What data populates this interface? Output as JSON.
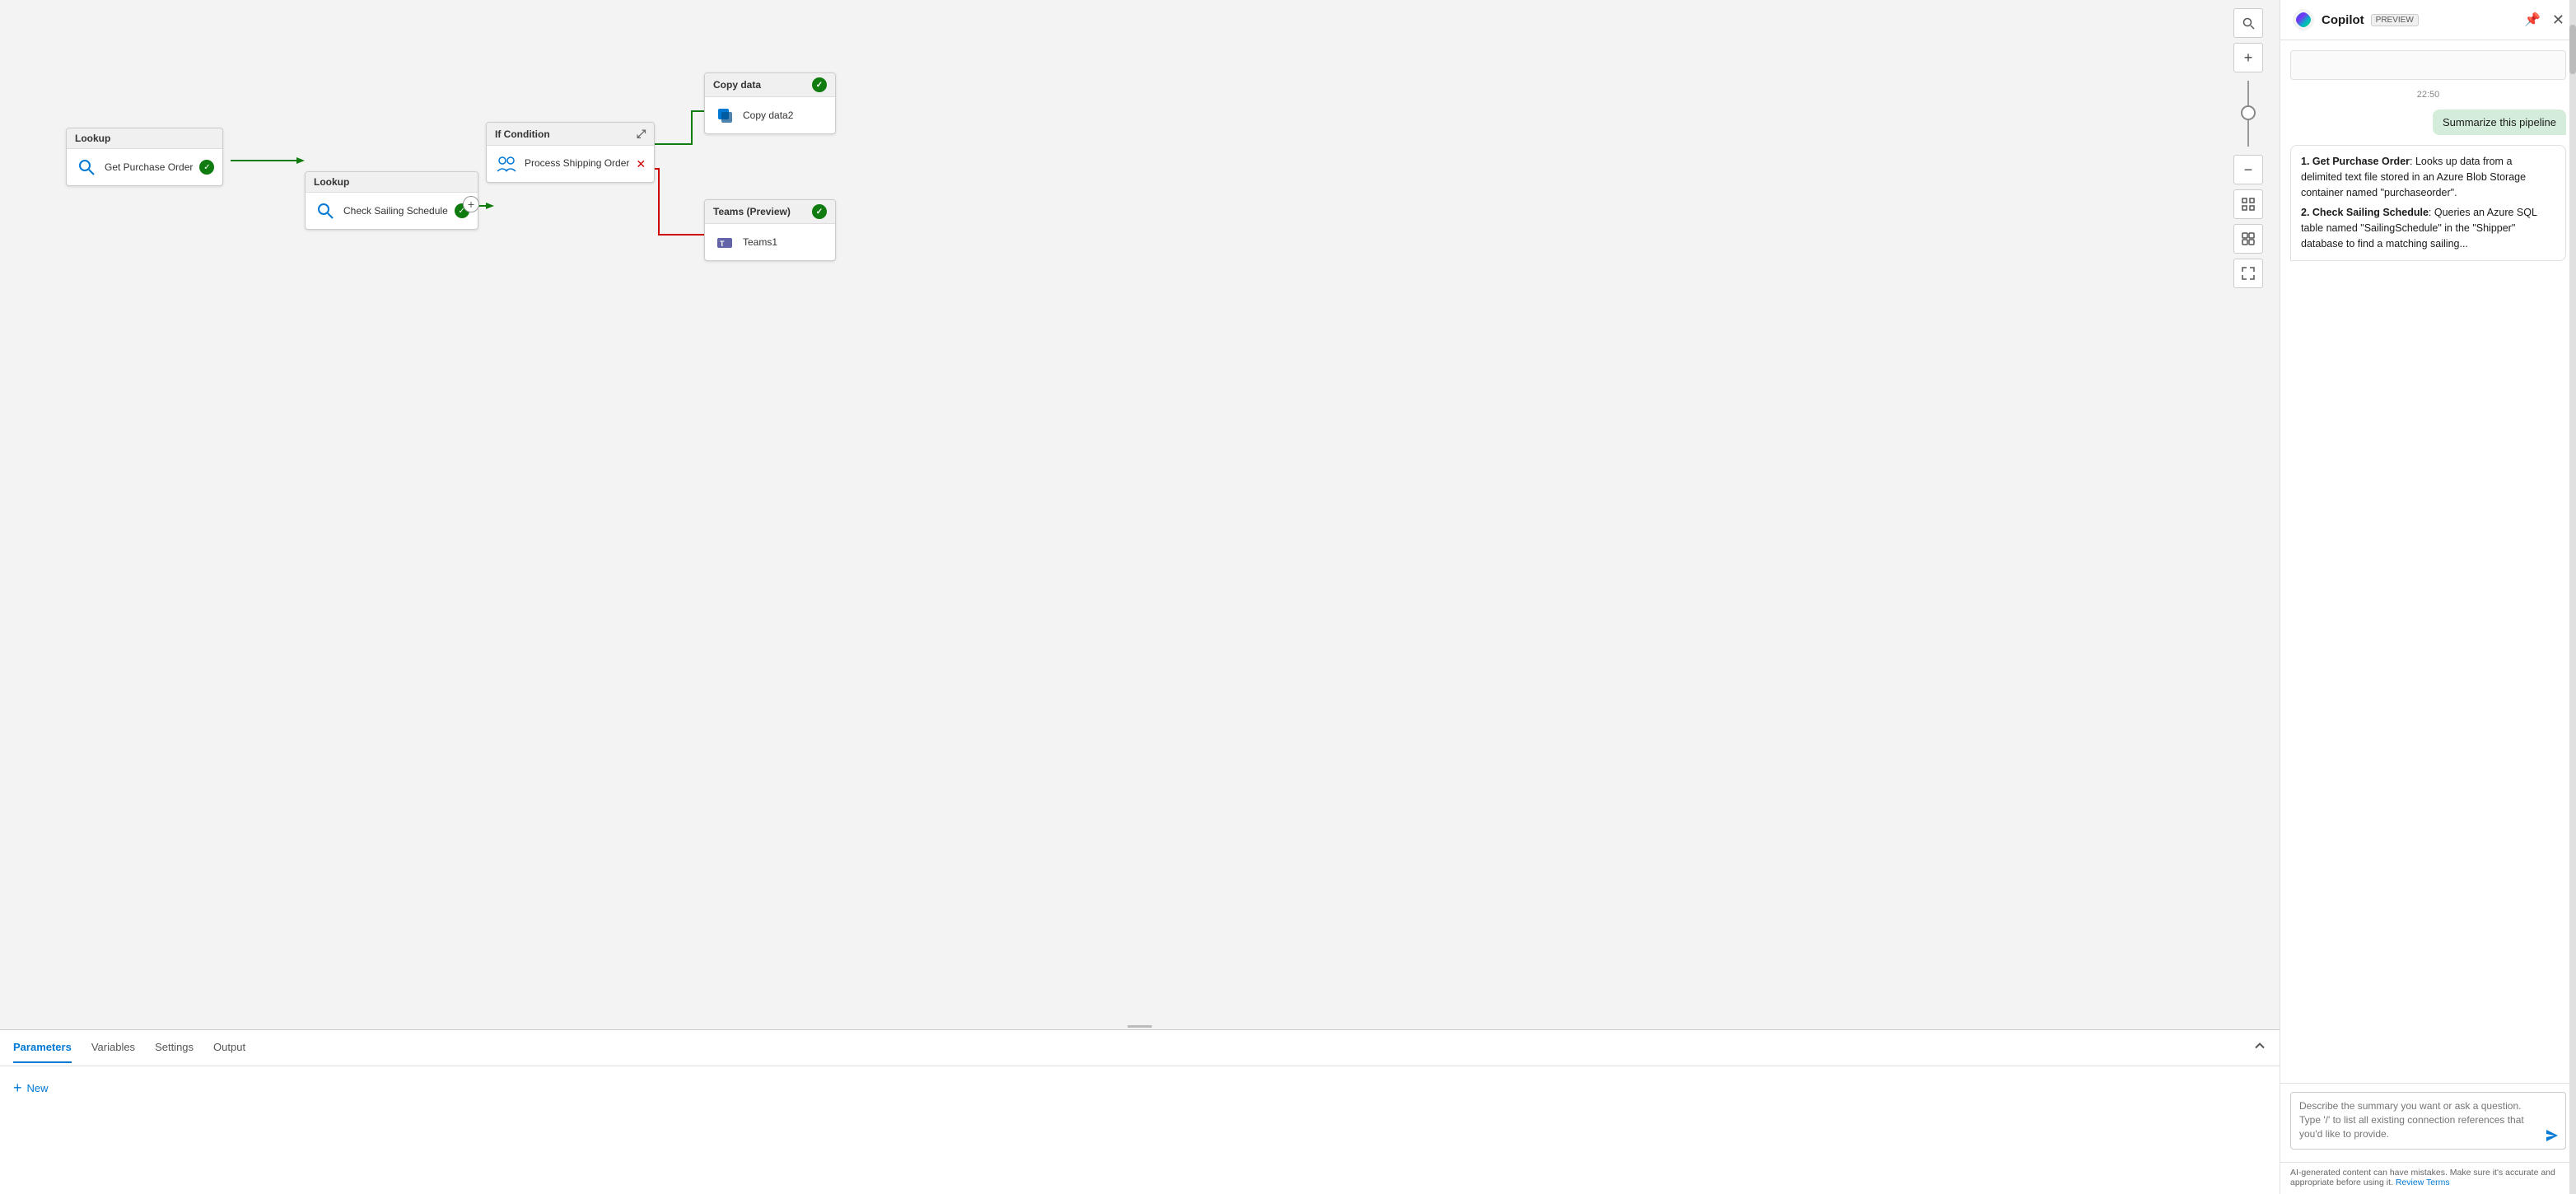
{
  "copilot": {
    "title": "Copilot",
    "preview": "PREVIEW",
    "timestamp": "22:50",
    "user_message": "Summarize this pipeline",
    "bot_message_items": [
      {
        "number": "1",
        "name": "Get Purchase Order",
        "description": ": Looks up data from a delimited text file stored in an Azure Blob Storage container named \"purchaseorder\"."
      },
      {
        "number": "2",
        "name": "Check Sailing Schedule",
        "description": ": Queries an Azure SQL table named \"SailingSchedule\" in the \"Shipper\" database to find a matching sailing..."
      }
    ],
    "input_placeholder_line1": "Describe the summary you want or ask a question.",
    "input_placeholder_line2": "Type '/' to list all existing connection references that you'd like to provide.",
    "footer_text": "AI-generated content can have mistakes. Make sure it's accurate and appropriate before using it.",
    "footer_link": "Review Terms"
  },
  "pipeline": {
    "nodes": {
      "lookup1": {
        "header": "Lookup",
        "body": "Get Purchase Order"
      },
      "lookup2": {
        "header": "Lookup",
        "body": "Check Sailing Schedule"
      },
      "if_condition": {
        "header": "If Condition",
        "body": ""
      },
      "process": {
        "header": "",
        "body": "Process Shipping Order"
      },
      "copy_data": {
        "header": "Copy data",
        "body": "Copy data2"
      },
      "teams": {
        "header": "Teams (Preview)",
        "body": "Teams1"
      }
    }
  },
  "bottom_panel": {
    "tabs": [
      "Parameters",
      "Variables",
      "Settings",
      "Output"
    ],
    "active_tab": "Parameters",
    "new_button": "New"
  },
  "toolbar": {
    "zoom_in": "+",
    "zoom_out": "−",
    "search": "🔍",
    "fit": "⊞",
    "expand": "⤢"
  }
}
